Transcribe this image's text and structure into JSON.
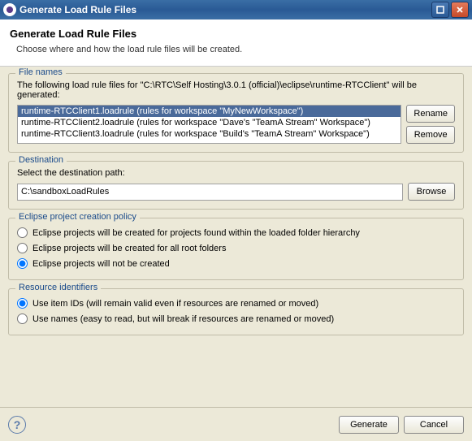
{
  "titlebar": {
    "title": "Generate Load Rule Files"
  },
  "header": {
    "title": "Generate Load Rule Files",
    "subtitle": "Choose where and how the load rule files will be created."
  },
  "fileNames": {
    "groupLabel": "File names",
    "description": "The following load rule files for \"C:\\RTC\\Self Hosting\\3.0.1 (official)\\eclipse\\runtime-RTCClient\" will be generated:",
    "items": [
      {
        "file": "runtime-RTCClient1.loadrule",
        "desc": "(rules for workspace \"MyNewWorkspace\")",
        "selected": true
      },
      {
        "file": "runtime-RTCClient2.loadrule",
        "desc": "(rules for workspace \"Dave's \"TeamA Stream\" Workspace\")",
        "selected": false
      },
      {
        "file": "runtime-RTCClient3.loadrule",
        "desc": "(rules for workspace \"Build's \"TeamA Stream\" Workspace\")",
        "selected": false
      }
    ],
    "renameLabel": "Rename",
    "removeLabel": "Remove"
  },
  "destination": {
    "groupLabel": "Destination",
    "prompt": "Select the destination path:",
    "value": "C:\\sandboxLoadRules",
    "browseLabel": "Browse"
  },
  "policy": {
    "groupLabel": "Eclipse project creation policy",
    "options": [
      "Eclipse projects will be created for projects found within the loaded folder hierarchy",
      "Eclipse projects will be created for all root folders",
      "Eclipse projects will not be created"
    ],
    "selectedIndex": 2
  },
  "resourceIds": {
    "groupLabel": "Resource identifiers",
    "options": [
      "Use item IDs (will remain valid even if resources are renamed or moved)",
      "Use names (easy to read, but will break if resources are renamed or moved)"
    ],
    "selectedIndex": 0
  },
  "footer": {
    "generateLabel": "Generate",
    "cancelLabel": "Cancel"
  }
}
